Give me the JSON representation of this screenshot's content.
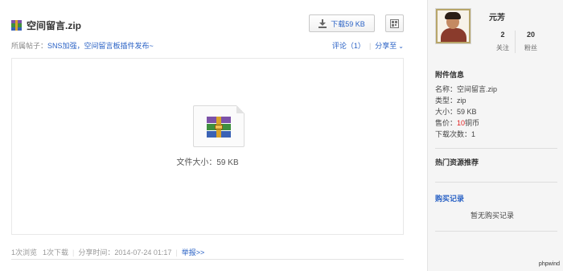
{
  "file": {
    "title": "空间留言.zip",
    "download_label": "下载59 KB",
    "post_prefix": "所属帖子：",
    "post_link": "SNS加强，空间留言板插件发布~",
    "comment_label": "评论（1）",
    "share_label": "分享至",
    "size_caption": "文件大小：59 KB"
  },
  "stats": {
    "views": "1次浏览",
    "downloads": "1次下载",
    "share_time": "分享时间：2014-07-24 01:17",
    "report": "举报>>"
  },
  "user": {
    "name": "元芳",
    "following_count": "2",
    "following_label": "关注",
    "fans_count": "20",
    "fans_label": "粉丝"
  },
  "attachment_info": {
    "title": "附件信息",
    "name_line": "名称：空间留言.zip",
    "type_line": "类型：zip",
    "size_line": "大小：59 KB",
    "price_prefix": "售价：",
    "price_value": "10",
    "price_unit": "铜币",
    "downloads_line": "下载次数：1"
  },
  "recommend": {
    "title": "热门资源推荐"
  },
  "purchase": {
    "title": "购买记录",
    "empty": "暂无购买记录"
  },
  "brand": "phpwind",
  "colors": {
    "link": "#2a62c5",
    "price": "#e02020",
    "sidebar_bg": "#f5f5f5"
  },
  "icons": [
    "zip-archive-icon",
    "download-icon",
    "qr-code-icon",
    "chevron-down-icon"
  ]
}
